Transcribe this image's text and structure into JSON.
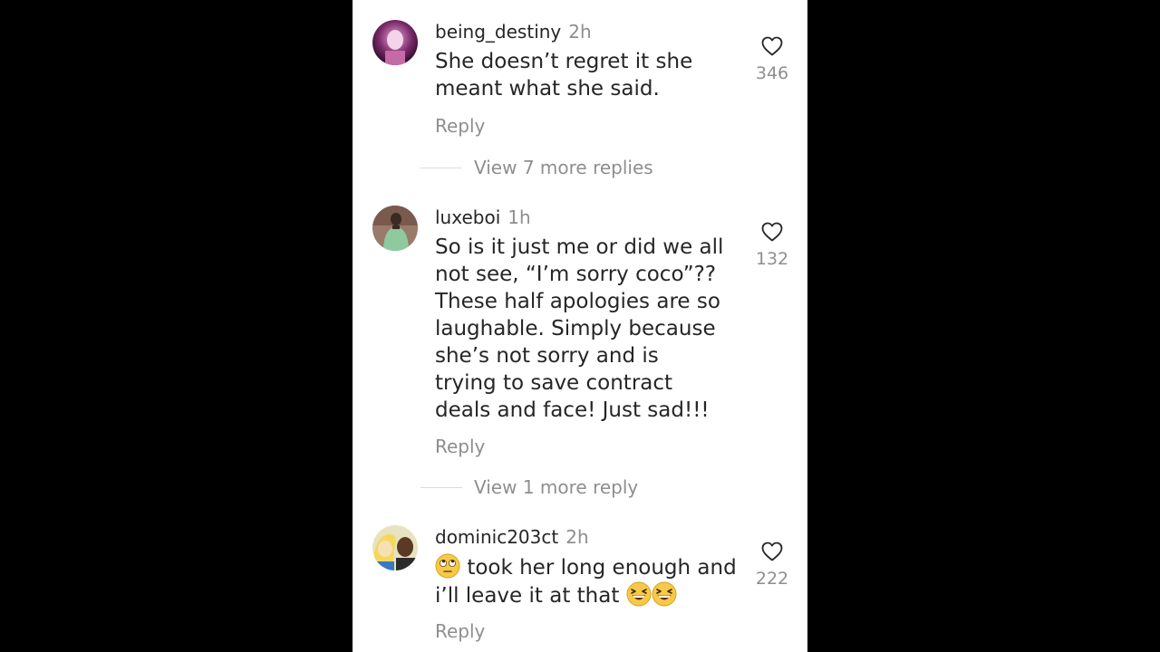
{
  "comments": [
    {
      "username": "being_destiny",
      "time": "2h",
      "text": "She doesn’t regret it she meant what she said.",
      "reply_label": "Reply",
      "likes": "346",
      "more_replies": "View 7 more replies"
    },
    {
      "username": "luxeboi",
      "time": "1h",
      "text": "So is it just me or did we all not see, “I’m sorry coco”?? These half apologies are so laughable. Simply because she’s not sorry and is trying to save contract deals and face! Just sad!!!",
      "reply_label": "Reply",
      "likes": "132",
      "more_replies": "View 1 more reply"
    },
    {
      "username": "dominic203ct",
      "time": "2h",
      "text_before": "took her long enough and i’ll leave it at that",
      "emoji_lead": "face-with-rolling-eyes-emoji",
      "emoji_trail": "grinning-squinting-face-emoji",
      "reply_label": "Reply",
      "likes": "222"
    }
  ],
  "colors": {
    "primary_text": "#262626",
    "secondary_text": "#8e8e8e",
    "divider": "#dbdbdb",
    "background": "#ffffff",
    "letterbox": "#000000"
  }
}
